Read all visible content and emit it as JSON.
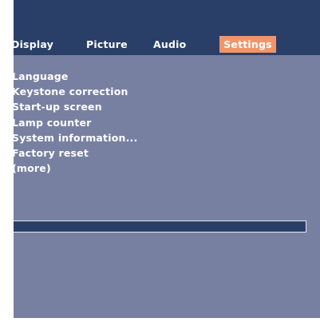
{
  "tabs": {
    "display": "Display",
    "picture": "Picture",
    "audio": "Audio",
    "settings": "Settings"
  },
  "active_tab": "Settings",
  "menu_items": [
    "Language",
    "Keystone correction",
    "Start-up screen",
    "Lamp counter",
    "System information...",
    "Factory reset",
    "(more)"
  ],
  "info_bar_text": "",
  "colors": {
    "header": "#2a3f68",
    "panel": "#7880a2",
    "active_tab": "#f0956b",
    "text": "#ffffff"
  }
}
